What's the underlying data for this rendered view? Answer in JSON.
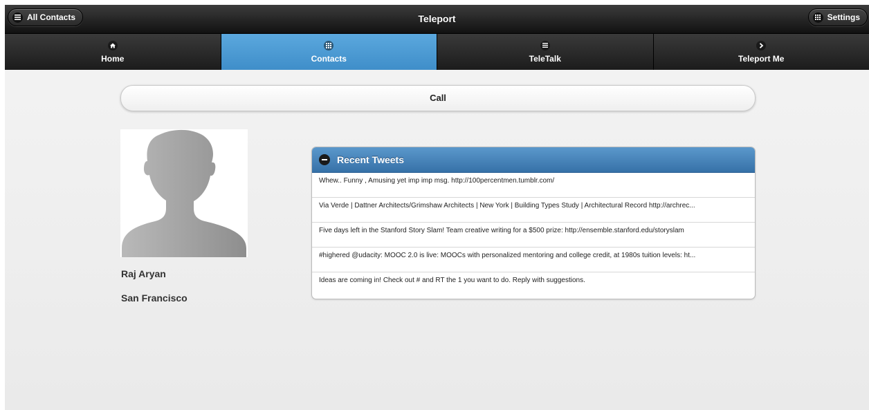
{
  "header": {
    "title": "Teleport",
    "left_button": {
      "label": "All Contacts",
      "icon": "list-icon"
    },
    "right_button": {
      "label": "Settings",
      "icon": "grid-icon"
    }
  },
  "navbar": {
    "items": [
      {
        "label": "Home",
        "icon": "home-icon",
        "active": false
      },
      {
        "label": "Contacts",
        "icon": "grid-icon",
        "active": true
      },
      {
        "label": "TeleTalk",
        "icon": "list-icon",
        "active": false
      },
      {
        "label": "Teleport Me",
        "icon": "arrow-right-icon",
        "active": false
      }
    ]
  },
  "call_button": {
    "label": "Call"
  },
  "profile": {
    "name": "Raj Aryan",
    "city": "San Francisco",
    "avatar": "person-silhouette-icon"
  },
  "tweets": {
    "title": "Recent Tweets",
    "items": [
      "Whew.. Funny , Amusing yet imp imp msg. http://100percentmen.tumblr.com/",
      "Via Verde | Dattner Architects/Grimshaw Architects | New York | Building Types Study | Architectural Record http://archrec...",
      "Five days left in the Stanford Story Slam! Team creative writing for a $500 prize: http://ensemble.stanford.edu/storyslam",
      "#highered @udacity: MOOC 2.0 is live: MOOCs with personalized mentoring and college credit, at 1980s tuition levels: ht...",
      "Ideas are coming in! Check out # and RT the 1 you want to do. Reply with suggestions."
    ]
  },
  "colors": {
    "header_bg": "#1e1e1e",
    "active_tab": "#4b9cd6",
    "tweets_header": "#4684bb",
    "page_bg": "#efefef"
  }
}
